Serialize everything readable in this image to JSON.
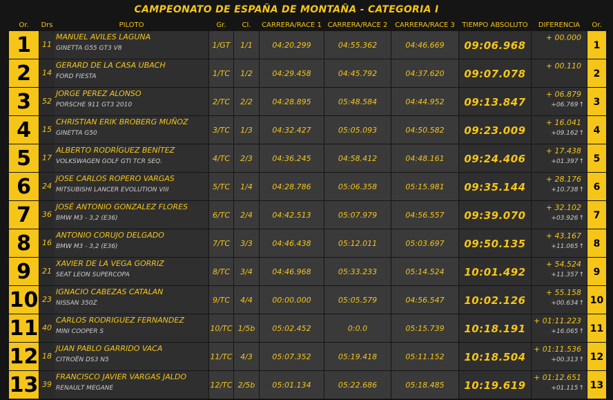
{
  "title": "CAMPEONATO DE ESPAÑA DE MONTAÑA - CATEGORIA I",
  "headers": {
    "or_left": "Or.",
    "drs": "Drs",
    "piloto": "PILOTO",
    "gr": "Gr.",
    "cl": "Cl.",
    "r1": "CARRERA/RACE 1",
    "r2": "CARRERA/RACE 2",
    "r3": "CARRERA/RACE 3",
    "abs": "TIEMPO ABSOLUTO",
    "dif": "DIFERENCIA",
    "or_right": "Or."
  },
  "rows": [
    {
      "pos": "1",
      "drs": "11",
      "name": "MANUEL AVILES LAGUNA",
      "car": "GINETTA G55 GT3 V8",
      "gr": "1/GT",
      "cl": "1/1",
      "r1": "04:20.299",
      "r2": "04:55.362",
      "r3": "04:46.669",
      "abs": "09:06.968",
      "dif": "+ 00.000",
      "dif2": ""
    },
    {
      "pos": "2",
      "drs": "14",
      "name": "GERARD DE LA CASA UBACH",
      "car": "FORD FIESTA",
      "gr": "1/TC",
      "cl": "1/2",
      "r1": "04:29.458",
      "r2": "04:45.792",
      "r3": "04:37.620",
      "abs": "09:07.078",
      "dif": "+ 00.110",
      "dif2": ""
    },
    {
      "pos": "3",
      "drs": "52",
      "name": "JORGE PEREZ ALONSO",
      "car": "PORSCHE 911 GT3 2010",
      "gr": "2/TC",
      "cl": "2/2",
      "r1": "04:28.895",
      "r2": "05:48.584",
      "r3": "04:44.952",
      "abs": "09:13.847",
      "dif": "+ 06.879",
      "dif2": "+06.769"
    },
    {
      "pos": "4",
      "drs": "15",
      "name": "CHRISTIAN ERIK BROBERG MUÑOZ",
      "car": "GINETTA G50",
      "gr": "3/TC",
      "cl": "1/3",
      "r1": "04:32.427",
      "r2": "05:05.093",
      "r3": "04:50.582",
      "abs": "09:23.009",
      "dif": "+ 16.041",
      "dif2": "+09.162"
    },
    {
      "pos": "5",
      "drs": "17",
      "name": "ALBERTO RODRÍGUEZ BENÍTEZ",
      "car": "VOLKSWAGEN GOLF GTI TCR SEQ.",
      "gr": "4/TC",
      "cl": "2/3",
      "r1": "04:36.245",
      "r2": "04:58.412",
      "r3": "04:48.161",
      "abs": "09:24.406",
      "dif": "+ 17.438",
      "dif2": "+01.397"
    },
    {
      "pos": "6",
      "drs": "24",
      "name": "JOSE CARLOS ROPERO VARGAS",
      "car": "MITSUBISHI LANCER EVOLUTION VIII",
      "gr": "5/TC",
      "cl": "1/4",
      "r1": "04:28.786",
      "r2": "05:06.358",
      "r3": "05:15.981",
      "abs": "09:35.144",
      "dif": "+ 28.176",
      "dif2": "+10.738"
    },
    {
      "pos": "7",
      "drs": "36",
      "name": "JOSÉ ANTONIO GONZALEZ FLORES",
      "car": "BMW M3 - 3,2 (E36)",
      "gr": "6/TC",
      "cl": "2/4",
      "r1": "04:42.513",
      "r2": "05:07.979",
      "r3": "04:56.557",
      "abs": "09:39.070",
      "dif": "+ 32.102",
      "dif2": "+03.926"
    },
    {
      "pos": "8",
      "drs": "16",
      "name": "ANTONIO CORUJO DELGADO",
      "car": "BMW M3 - 3,2 (E36)",
      "gr": "7/TC",
      "cl": "3/3",
      "r1": "04:46.438",
      "r2": "05:12.011",
      "r3": "05:03.697",
      "abs": "09:50.135",
      "dif": "+ 43.167",
      "dif2": "+11.065"
    },
    {
      "pos": "9",
      "drs": "21",
      "name": "XAVIER DE LA VEGA GORRIZ",
      "car": "SEAT LEON SUPERCOPA",
      "gr": "8/TC",
      "cl": "3/4",
      "r1": "04:46.968",
      "r2": "05:33.233",
      "r3": "05:14.524",
      "abs": "10:01.492",
      "dif": "+ 54.524",
      "dif2": "+11.357"
    },
    {
      "pos": "10",
      "drs": "23",
      "name": "IGNACIO CABEZAS CATALAN",
      "car": "NISSAN 350Z",
      "gr": "9/TC",
      "cl": "4/4",
      "r1": "00:00.000",
      "r2": "05:05.579",
      "r3": "04:56.547",
      "abs": "10:02.126",
      "dif": "+ 55.158",
      "dif2": "+00.634"
    },
    {
      "pos": "11",
      "drs": "40",
      "name": "CARLOS RODRIGUEZ FERNANDEZ",
      "car": "MINI COOPER S",
      "gr": "10/TC",
      "cl": "1/5b",
      "r1": "05:02.452",
      "r2": "0:0.0",
      "r3": "05:15.739",
      "abs": "10:18.191",
      "dif": "+ 01:11.223",
      "dif2": "+16.065"
    },
    {
      "pos": "12",
      "drs": "18",
      "name": "JUAN PABLO GARRIDO VACA",
      "car": "CITROËN DS3 N5",
      "gr": "11/TC",
      "cl": "4/3",
      "r1": "05:07.352",
      "r2": "05:19.418",
      "r3": "05:11.152",
      "abs": "10:18.504",
      "dif": "+ 01:11.536",
      "dif2": "+00.313"
    },
    {
      "pos": "13",
      "drs": "39",
      "name": "FRANCISCO JAVIER VARGAS JALDO",
      "car": "RENAULT MEGANE",
      "gr": "12/TC",
      "cl": "2/5b",
      "r1": "05:01.134",
      "r2": "05:22.686",
      "r3": "05:18.485",
      "abs": "10:19.619",
      "dif": "+ 01:12.651",
      "dif2": "+01.115"
    }
  ]
}
